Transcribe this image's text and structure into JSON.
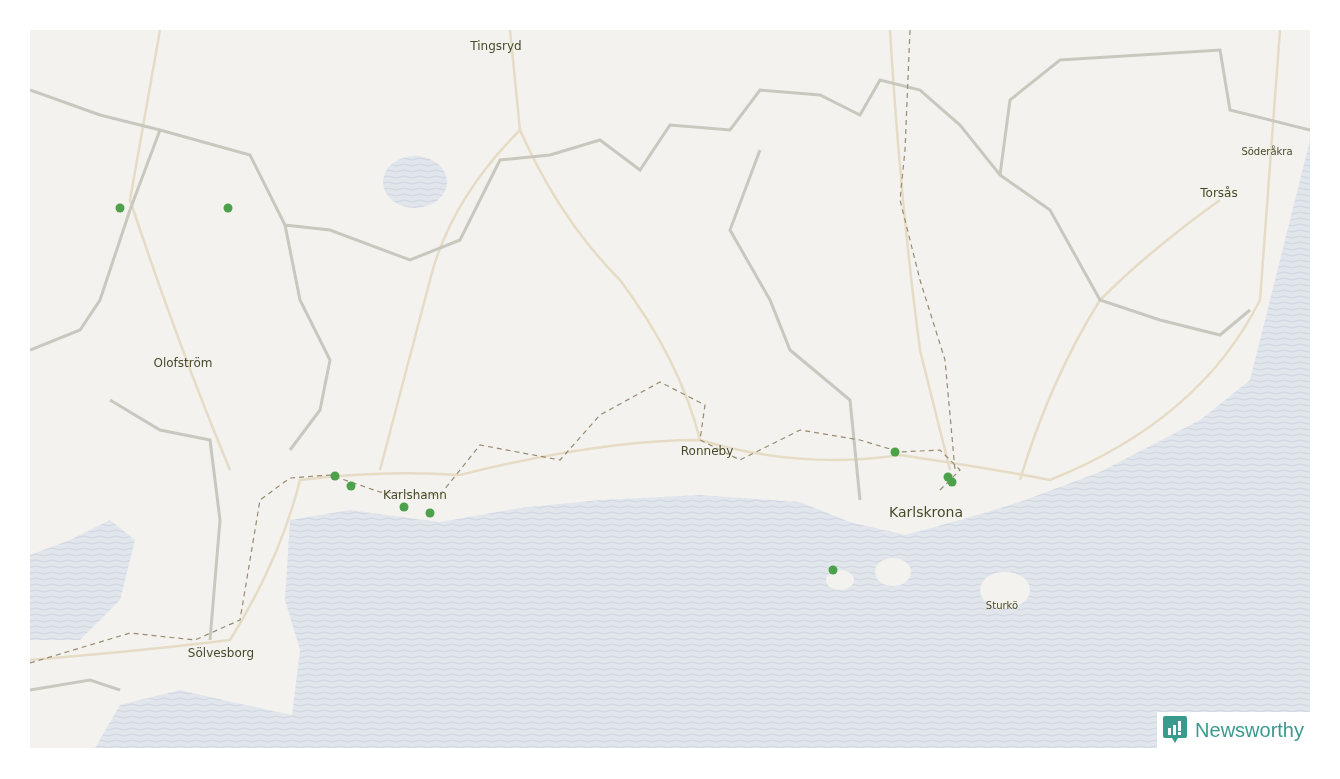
{
  "map": {
    "place_labels": [
      {
        "name": "Tingsryd",
        "kind": "town"
      },
      {
        "name": "Söderåkra",
        "kind": "village"
      },
      {
        "name": "Torsås",
        "kind": "town"
      },
      {
        "name": "Olofström",
        "kind": "town"
      },
      {
        "name": "Ronneby",
        "kind": "town"
      },
      {
        "name": "Karlshamn",
        "kind": "town"
      },
      {
        "name": "Karlskrona",
        "kind": "city"
      },
      {
        "name": "Sturkö",
        "kind": "village"
      },
      {
        "name": "Sölvesborg",
        "kind": "town"
      }
    ]
  },
  "logo": {
    "text": "Newsworthy"
  }
}
